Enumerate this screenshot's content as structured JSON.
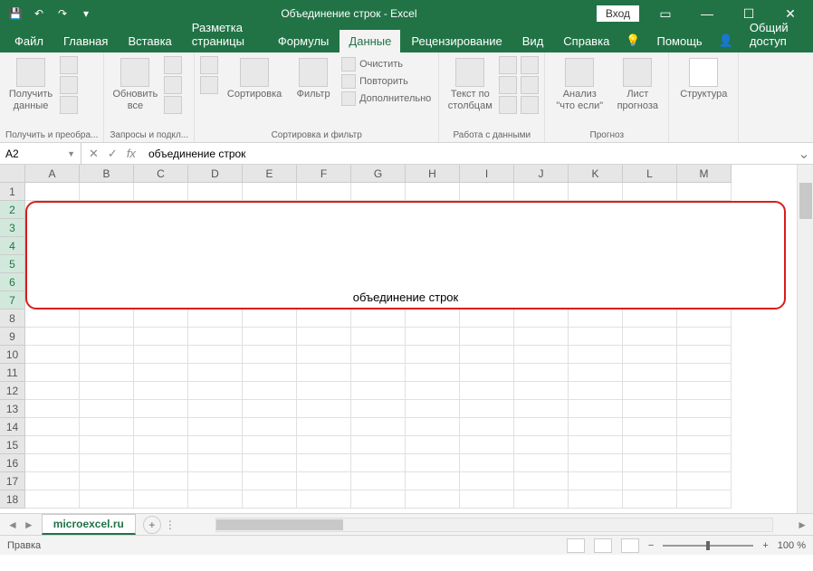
{
  "title": "Объединение строк  -  Excel",
  "login_label": "Вход",
  "tabs": [
    "Файл",
    "Главная",
    "Вставка",
    "Разметка страницы",
    "Формулы",
    "Данные",
    "Рецензирование",
    "Вид",
    "Справка",
    "Помощь",
    "Общий доступ"
  ],
  "active_tab_index": 5,
  "ribbon": {
    "group1": {
      "btn": "Получить\nданные",
      "label": "Получить и преобра..."
    },
    "group2": {
      "btn": "Обновить\nвсе",
      "label": "Запросы и подкл..."
    },
    "group3": {
      "sort": "Сортировка",
      "filter": "Фильтр",
      "clear": "Очистить",
      "reapply": "Повторить",
      "advanced": "Дополнительно",
      "label": "Сортировка и фильтр"
    },
    "group4": {
      "btn": "Текст по\nстолбцам",
      "label": "Работа с данными"
    },
    "group5": {
      "btn1": "Анализ \"что\nесли\"",
      "btn2": "Лист\nпрогноза",
      "label": "Прогноз"
    },
    "group6": {
      "btn": "Структура",
      "label": ""
    }
  },
  "name_box": "A2",
  "formula": "объединение строк",
  "columns": [
    "A",
    "B",
    "C",
    "D",
    "E",
    "F",
    "G",
    "H",
    "I",
    "J",
    "K",
    "L",
    "M"
  ],
  "rows": [
    "1",
    "2",
    "3",
    "4",
    "5",
    "6",
    "7",
    "8",
    "9",
    "10",
    "11",
    "12",
    "13",
    "14",
    "15",
    "16",
    "17",
    "18"
  ],
  "merged_text": "объединение строк",
  "sheet_name": "microexcel.ru",
  "status": "Правка",
  "zoom": "100 %",
  "chart_data": null
}
